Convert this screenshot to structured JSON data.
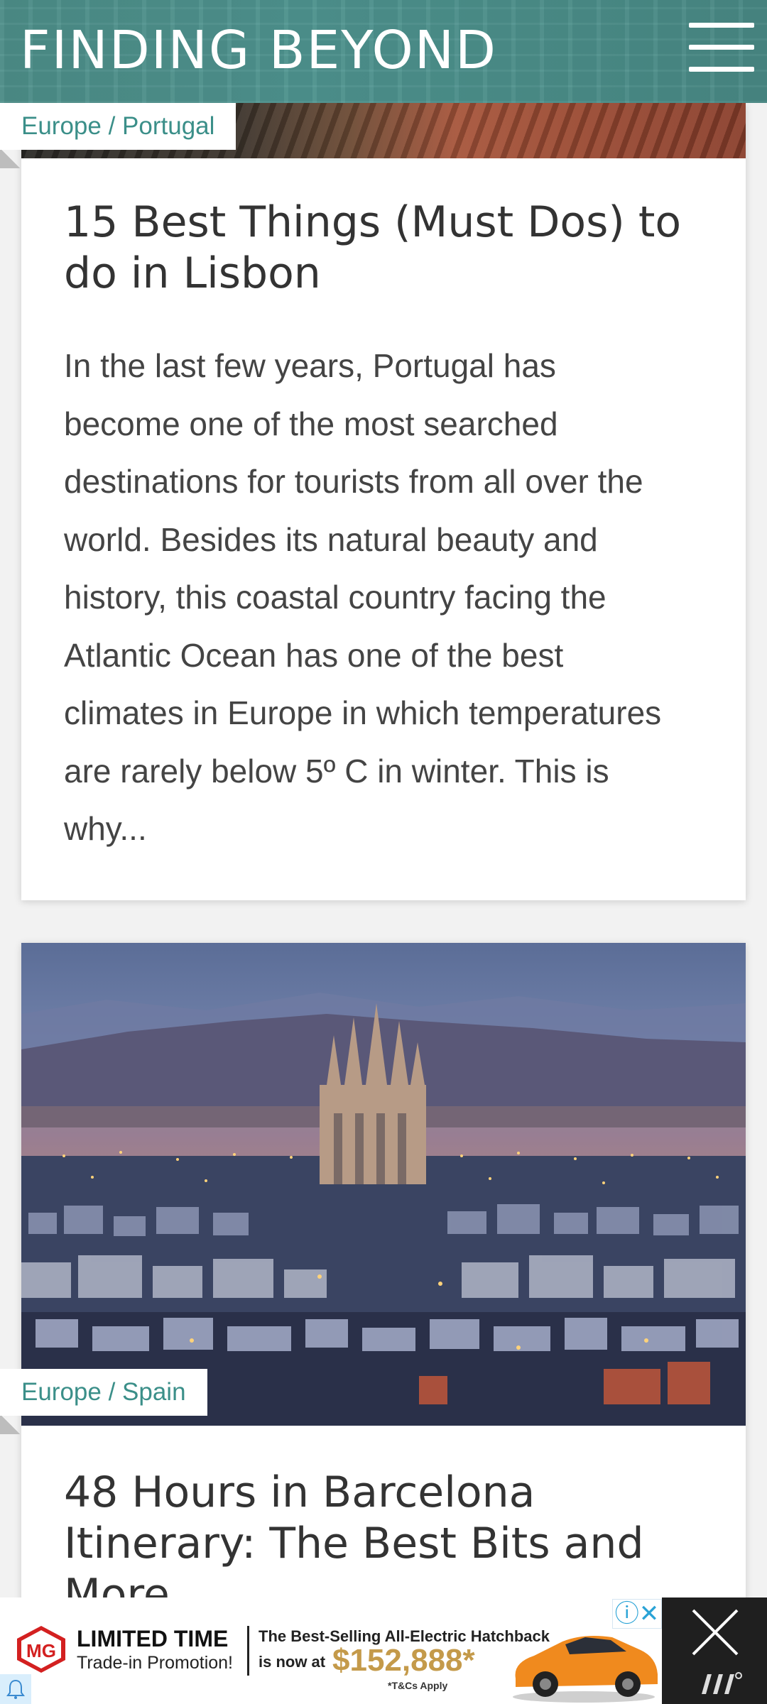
{
  "header": {
    "site_title": "FINDING BEYOND",
    "menu_icon": "hamburger-menu-icon",
    "background_color": "#4e8f8a"
  },
  "posts": [
    {
      "category": "Europe / Portugal",
      "title": "15 Best Things (Must Dos) to do in Lisbon",
      "excerpt_lines": [
        "In the last few years, Portugal has",
        "become one of the most searched",
        "destinations for tourists from all over the",
        "world. Besides its natural beauty and",
        "history, this coastal country facing the",
        "Atlantic Ocean has one of the best",
        "climates in Europe in which temperatures",
        "are rarely below 5º C in winter. This is",
        "why..."
      ]
    },
    {
      "category": "Europe / Spain",
      "title_lines": [
        "48 Hours in Barcelona",
        "Itinerary: The Best Bits and",
        "More"
      ]
    }
  ],
  "ad": {
    "brand": "MG",
    "headline": "LIMITED TIME",
    "subline": "Trade-in Promotion!",
    "tagline_1": "The Best-Selling All-Electric Hatchback",
    "tagline_2": "is now at",
    "price": "$152,888*",
    "terms": "*T&Cs Apply",
    "adchoices_label": "ⓘ✕",
    "close_icon": "close-icon",
    "accent_color": "#c49a4a"
  },
  "colors": {
    "category_text": "#3b8f89",
    "title_text": "#333333"
  }
}
